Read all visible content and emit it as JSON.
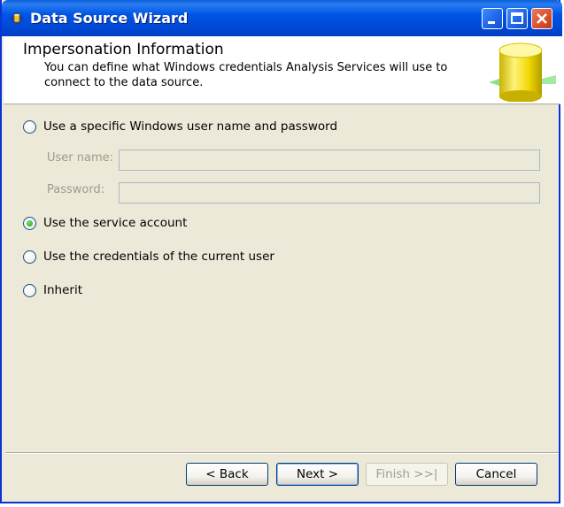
{
  "window": {
    "title": "Data Source Wizard"
  },
  "header": {
    "title": "Impersonation Information",
    "description": "You can define what Windows credentials Analysis Services will use to connect to the data source."
  },
  "options": [
    {
      "label": "Use a specific Windows user name and password",
      "checked": false
    },
    {
      "label": "Use the service account",
      "checked": true
    },
    {
      "label": "Use the credentials of the current user",
      "checked": false
    },
    {
      "label": "Inherit",
      "checked": false
    }
  ],
  "fields": {
    "username_label": "User name:",
    "username_value": "",
    "password_label": "Password:",
    "password_value": "",
    "enabled": false
  },
  "buttons": {
    "back": "< Back",
    "next": "Next >",
    "finish": "Finish >>|",
    "cancel": "Cancel"
  },
  "colors": {
    "titlebar": "#0055e5",
    "dialog_bg": "#ece9d8",
    "accent_green": "#21a121"
  }
}
